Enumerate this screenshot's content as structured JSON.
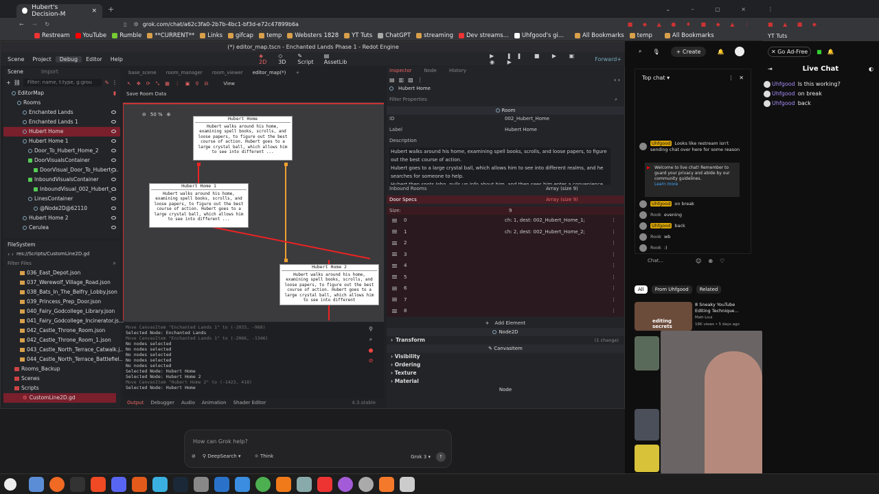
{
  "browser": {
    "tab_title": "Hubert's Decision-M",
    "url": "grok.com/chat/a62c3fa0-2b7b-4bc1-bf3d-e72c47899b6a",
    "bookmarks": [
      "Restream",
      "YouTube",
      "Rumble",
      "**CURRENT**",
      "Links",
      "gifcap",
      "temp",
      "Websters 1828",
      "YT Tuts",
      "ChatGPT",
      "streaming",
      "Dev streams...",
      "Uhfgood's gi..."
    ],
    "all_bookmarks": "All Bookmarks",
    "right_bookmarks": [
      "temp"
    ],
    "far_right_bookmark": "YT Tuts"
  },
  "godot": {
    "title": "(*) editor_map.tscn - Enchanted Lands Phase 1 - Redot Engine",
    "menu": [
      "Scene",
      "Project",
      "Debug",
      "Editor",
      "Help"
    ],
    "workspace": [
      "2D",
      "3D",
      "Script",
      "AssetLib"
    ],
    "renderer": "Forward+",
    "scene_tabs_left": [
      "Scene",
      "Import"
    ],
    "scene_tabs": [
      "base_scene",
      "room_manager",
      "room_viewer",
      "editor_map(*)"
    ],
    "filter_placeholder": "Filter: name, t:type, g:grou",
    "tree": [
      {
        "label": "EditorMap",
        "indent": 0
      },
      {
        "label": "Rooms",
        "indent": 1
      },
      {
        "label": "Enchanted Lands",
        "indent": 2
      },
      {
        "label": "Enchanted Lands 1",
        "indent": 2
      },
      {
        "label": "Hubert Home",
        "indent": 2
      },
      {
        "label": "Hubert Home 1",
        "indent": 2
      },
      {
        "label": "Door_To_Hubert_Home_2",
        "indent": 3
      },
      {
        "label": "DoorVisualsContainer",
        "indent": 3
      },
      {
        "label": "DoorVisual_Door_To_Hubert_...",
        "indent": 4
      },
      {
        "label": "InboundVisualsContainer",
        "indent": 3
      },
      {
        "label": "InboundVisual_002_Hubert_...",
        "indent": 4
      },
      {
        "label": "LinesContainer",
        "indent": 3
      },
      {
        "label": "@Node2D@62110",
        "indent": 4
      },
      {
        "label": "Hubert Home 2",
        "indent": 2
      },
      {
        "label": "Cerulea",
        "indent": 2
      }
    ],
    "filesystem_title": "FileSystem",
    "fs_path": "res://Scripts/CustomLine2D.gd",
    "filter_files": "Filter Files",
    "files": [
      "036_East_Depot.json",
      "037_Werewolf_Village_Road.json",
      "038_Bats_In_The_Belfry_Lobby.json",
      "039_Princess_Prep_Door.json",
      "040_Fairy_Godcollege_Library.json",
      "041_Fairy_Godcollege_Incinerator.js...",
      "042_Castle_Throne_Room.json",
      "042_Castle_Throne_Room_1.json",
      "043_Castle_North_Terrace_Catwalk.j...",
      "044_Castle_North_Terrace_Battlefiel..."
    ],
    "folders": [
      "Rooms_Backup",
      "Scenes",
      "Scripts"
    ],
    "selected_file": "CustomLine2D.gd",
    "viewport_toolbar": {
      "view": "View",
      "save_room": "Save Room Data",
      "zoom": "50 %"
    },
    "nodes": [
      {
        "title": "Hubert Home",
        "text": "Hubert walks around his home, examining spell books, scrolls, and loose papers, to figure out the best course of action. Hubert goes to a large crystal ball, which allows him to see into different ..."
      },
      {
        "title": "Hubert Home 1",
        "text": "Hubert walks around his home, examining spell books, scrolls, and loose papers, to figure out the best course of action. Hubert goes to a large crystal ball, which allows him to see into different ..."
      },
      {
        "title": "Hubert Home 2",
        "text": "Hubert walks around his home, examining spell books, scrolls, and loose papers, to figure out the best course of action. Hubert goes to a large crystal ball, which allows him to see into different"
      }
    ],
    "output_lines": [
      {
        "t": "Move CanvasItem \"Enchanted Lands 1\" to (-2033, -968)",
        "dim": true
      },
      {
        "t": "Selected Node: Enchanted Lands",
        "dim": false
      },
      {
        "t": "Move CanvasItem \"Enchanted Lands 1\" to (-2066, -1346)",
        "dim": true
      },
      {
        "t": "No nodes selected",
        "dim": false
      },
      {
        "t": "No nodes selected",
        "dim": false
      },
      {
        "t": "No nodes selected",
        "dim": false
      },
      {
        "t": "No nodes selected",
        "dim": false
      },
      {
        "t": "No nodes selected",
        "dim": false
      },
      {
        "t": "Selected Node: Hubert Home",
        "dim": false
      },
      {
        "t": "Selected Node: Hubert Home 2",
        "dim": false
      },
      {
        "t": "Move CanvasItem \"Hubert Home 2\" to (-1423, 418)",
        "dim": true
      },
      {
        "t": "Selected Node: Hubert Home",
        "dim": false
      }
    ],
    "bottom_tabs": [
      "Output",
      "Debugger",
      "Audio",
      "Animation",
      "Shader Editor"
    ],
    "version": "4.3.stable",
    "inspector": {
      "tabs": [
        "Inspector",
        "Node",
        "History"
      ],
      "node_name": "Hubert Home",
      "filter": "Filter Properties",
      "class": "Room",
      "id_label": "ID",
      "id_value": "002_Hubert_Home",
      "label_label": "Label",
      "label_value": "Hubert Home",
      "desc_label": "Description",
      "description": "Hubert walks around his home, examining spell books, scrolls, and loose papers, to figure out the best course of action.\nHubert goes to a large crystal ball, which allows him to see into different realms, and he searches for someone to help.\nHubert then spots John, pulls up info about him, and then sees him enter a convenience",
      "inbound_label": "Inbound Rooms",
      "inbound_value": "Array (size 9)",
      "door_label": "Door Specs",
      "door_value": "Array (size 9)",
      "size_label": "Size:",
      "size_value": "9",
      "doors": [
        {
          "i": "0",
          "v": "ch: 1, dest: 002_Hubert_Home_1;"
        },
        {
          "i": "1",
          "v": "ch: 2, dest: 002_Hubert_Home_2;"
        },
        {
          "i": "2",
          "v": ""
        },
        {
          "i": "3",
          "v": ""
        },
        {
          "i": "4",
          "v": ""
        },
        {
          "i": "5",
          "v": ""
        },
        {
          "i": "6",
          "v": ""
        },
        {
          "i": "7",
          "v": ""
        },
        {
          "i": "8",
          "v": ""
        }
      ],
      "add_element": "Add Element",
      "node2d": "Node2D",
      "transform": "Transform",
      "change": "(1 change)",
      "canvasitem": "CanvasItem",
      "sections": [
        "Visibility",
        "Ordering",
        "Texture",
        "Material"
      ],
      "node": "Node"
    }
  },
  "youtube": {
    "create": "Create",
    "top_chat": "Top chat",
    "messages": [
      {
        "user": "Uhfgood",
        "text": "Looks like restream isn't sending chat over here for some reason"
      },
      {
        "user": "",
        "text": "Welcome to live chat! Remember to guard your privacy and abide by our community guidelines."
      },
      {
        "user": "Uhfgood",
        "text": "on break"
      },
      {
        "user": "Rook",
        "text": "evening"
      },
      {
        "user": "Uhfgood",
        "text": "back"
      },
      {
        "user": "Rook",
        "text": "wb"
      },
      {
        "user": "Rook",
        "text": ":)"
      }
    ],
    "learn_more": "Learn more",
    "chat_placeholder": "Chat...",
    "filters": [
      "All",
      "From Uhfgood",
      "Related"
    ],
    "video_title": "8 Sneaky YouTube Editing Technique...",
    "video_channel": "Matt Loui",
    "video_meta": "16K views • 5 days ago",
    "thumb_text": "editing secrets"
  },
  "rchat": {
    "go_ad_free": "Go Ad-Free",
    "title": "Live Chat",
    "messages": [
      {
        "user": "Uhfgood",
        "text": "Is this working?"
      },
      {
        "user": "Uhfgood",
        "text": "on break"
      },
      {
        "user": "Uhfgood",
        "text": "back"
      }
    ]
  },
  "grok": {
    "placeholder": "How can Grok help?",
    "deepsearch": "DeepSearch",
    "think": "Think",
    "model": "Grok 3"
  }
}
